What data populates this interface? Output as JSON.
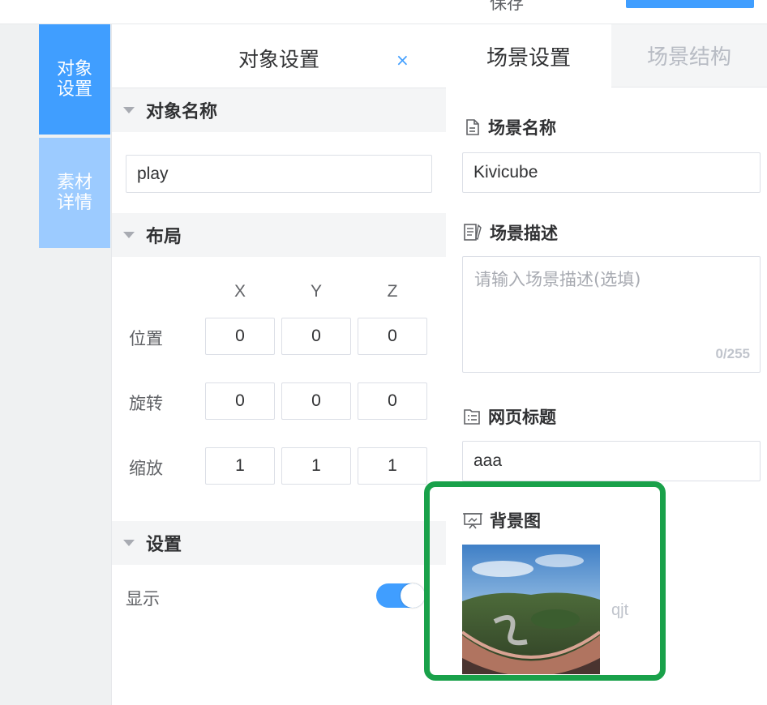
{
  "topbar": {
    "save_label": "保存"
  },
  "rail": {
    "tabs": [
      {
        "label": "对象设置",
        "active": true
      },
      {
        "label": "素材详情",
        "active": false
      }
    ]
  },
  "object_panel": {
    "title": "对象设置",
    "close_glyph": "×",
    "sections": {
      "name": {
        "label": "对象名称",
        "value": "play"
      },
      "layout": {
        "label": "布局",
        "axes": [
          "X",
          "Y",
          "Z"
        ],
        "rows": [
          {
            "label": "位置",
            "values": [
              "0",
              "0",
              "0"
            ]
          },
          {
            "label": "旋转",
            "values": [
              "0",
              "0",
              "0"
            ]
          },
          {
            "label": "缩放",
            "values": [
              "1",
              "1",
              "1"
            ]
          }
        ]
      },
      "settings": {
        "label": "设置",
        "display_label": "显示",
        "display_on": true
      }
    }
  },
  "scene_panel": {
    "tabs": [
      {
        "label": "场景设置",
        "active": true
      },
      {
        "label": "场景结构",
        "active": false
      }
    ],
    "name": {
      "label": "场景名称",
      "value": "Kivicube",
      "icon": "document-icon"
    },
    "description": {
      "label": "场景描述",
      "placeholder": "请输入场景描述(选填)",
      "counter": "0/255",
      "icon": "edit-document-icon"
    },
    "page_title": {
      "label": "网页标题",
      "value": "aaa",
      "icon": "list-document-icon"
    },
    "background": {
      "label": "背景图",
      "image_name": "qjt",
      "icon": "presentation-icon"
    }
  },
  "colors": {
    "accent": "#409eff",
    "accent_light": "#9ccbff",
    "highlight_box": "#19a14a"
  }
}
